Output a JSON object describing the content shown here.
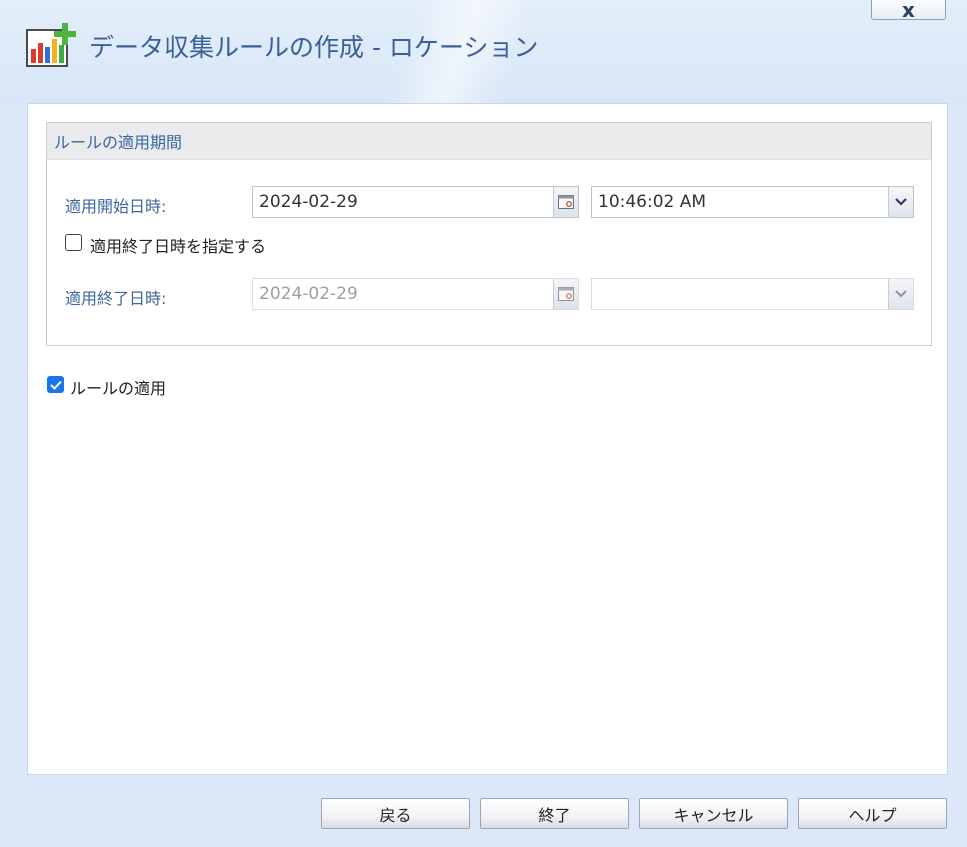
{
  "window": {
    "title": "データ収集ルールの作成 - ロケーション",
    "close_label": "x"
  },
  "group": {
    "title": "ルールの適用期間",
    "start": {
      "label": "適用開始日時:",
      "date": "2024-02-29",
      "time": "10:46:02 AM"
    },
    "end_checkbox": {
      "label": "適用終了日時を指定する",
      "checked": false
    },
    "end": {
      "label": "適用終了日時:",
      "date": "2024-02-29",
      "time": ""
    }
  },
  "apply_rule": {
    "label": "ルールの適用",
    "checked": true
  },
  "buttons": {
    "back": "戻る",
    "finish": "終了",
    "cancel": "キャンセル",
    "help": "ヘルプ"
  },
  "icons": {
    "app": "chart-add-icon",
    "calendar": "calendar-icon",
    "dropdown": "chevron-down-icon"
  }
}
